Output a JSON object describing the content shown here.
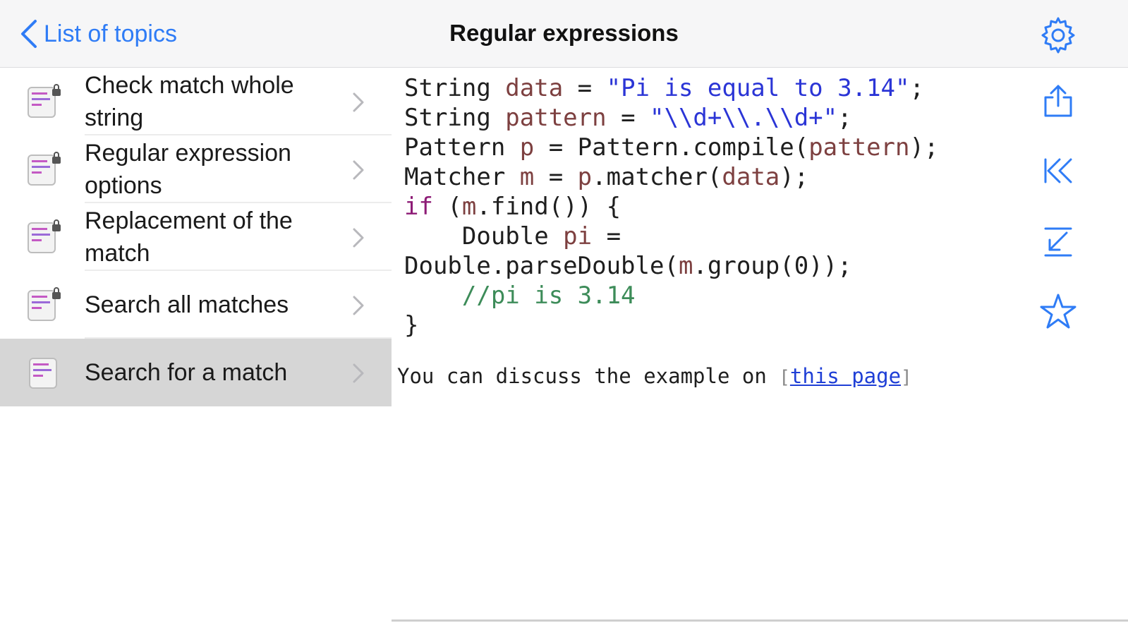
{
  "nav": {
    "back_label": "List of topics",
    "title": "Regular expressions",
    "settings_icon": "gear-icon"
  },
  "topics": [
    {
      "label": "Check match whole string",
      "selected": false,
      "icon": "locked-code-file-icon"
    },
    {
      "label": "Regular expression options",
      "selected": false,
      "icon": "locked-code-file-icon"
    },
    {
      "label": "Replacement of the match",
      "selected": false,
      "icon": "locked-code-file-icon"
    },
    {
      "label": "Search all matches",
      "selected": false,
      "icon": "locked-code-file-icon"
    },
    {
      "label": "Search for a match",
      "selected": true,
      "icon": "code-file-icon"
    }
  ],
  "code": {
    "lines": [
      "String data = \"Pi is equal to 3.14\";",
      "String pattern = \"\\\\d+\\\\.\\\\d+\";",
      "Pattern p = Pattern.compile(pattern);",
      "Matcher m = p.matcher(data);",
      "if (m.find()) {",
      "    Double pi =",
      "Double.parseDouble(m.group(0));",
      "    //pi is 3.14",
      "}"
    ]
  },
  "discussion": {
    "prefix": "You can discuss the example on ",
    "open_bracket": "[",
    "link_text": "this page",
    "close_bracket": "]"
  },
  "toolbar": {
    "icons": [
      "share-icon",
      "first-topic-icon",
      "download-icon",
      "favorite-star-icon"
    ]
  },
  "colors": {
    "accent": "#2f7cf6",
    "keyword": "#8d1b76",
    "variable": "#7d4040",
    "string": "#2b35d6",
    "comment": "#3d8c59",
    "selected_row": "#d6d6d6"
  }
}
